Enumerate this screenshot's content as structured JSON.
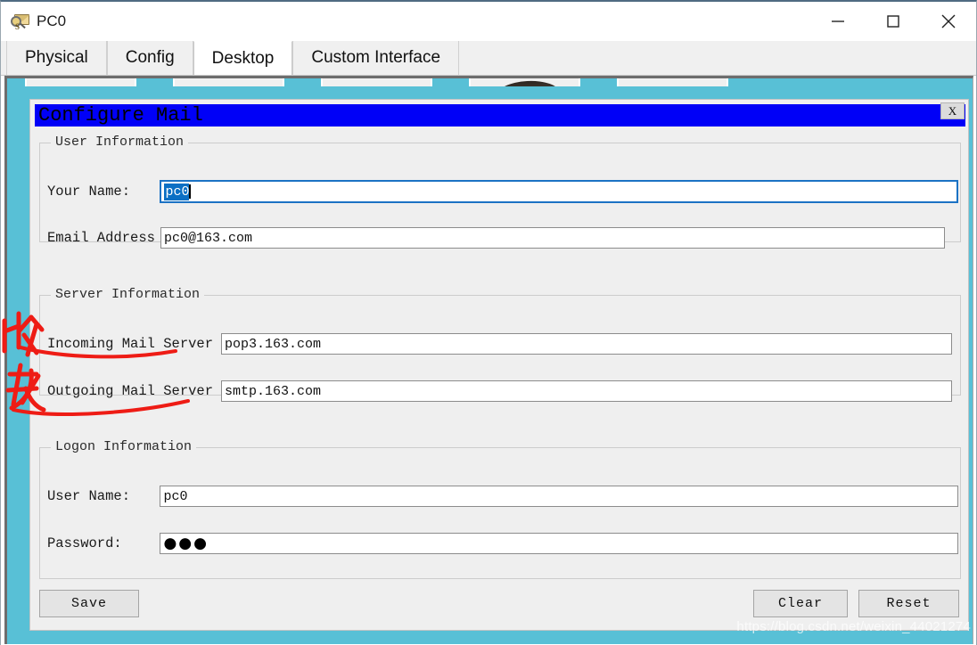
{
  "window": {
    "title": "PC0",
    "icon": "mail-search-icon",
    "controls": {
      "minimize": "minimize-icon",
      "maximize": "maximize-icon",
      "close": "close-icon"
    }
  },
  "tabs": [
    {
      "label": "Physical",
      "active": false
    },
    {
      "label": "Config",
      "active": false
    },
    {
      "label": "Desktop",
      "active": true
    },
    {
      "label": "Custom Interface",
      "active": false
    }
  ],
  "dialog": {
    "title": "Configure Mail",
    "close_label": "X",
    "titlebar_color": "#0000f7",
    "groups": {
      "user": {
        "title": "User Information",
        "fields": [
          {
            "label": "Your Name:",
            "value": "pc0",
            "focused": true,
            "selected": true
          },
          {
            "label": "Email Address",
            "value": "pc0@163.com",
            "focused": false,
            "selected": false
          }
        ]
      },
      "server": {
        "title": "Server Information",
        "fields": [
          {
            "label": "Incoming Mail Server",
            "value": "pop3.163.com",
            "focused": false,
            "selected": false
          },
          {
            "label": "Outgoing Mail Server",
            "value": "smtp.163.com",
            "focused": false,
            "selected": false
          }
        ]
      },
      "logon": {
        "title": "Logon Information",
        "fields": [
          {
            "label": "User Name:",
            "value": "pc0",
            "focused": false,
            "selected": false
          },
          {
            "label": "Password:",
            "value": "●●●",
            "focused": false,
            "selected": false
          }
        ]
      }
    },
    "buttons": {
      "save": "Save",
      "clear": "Clear",
      "reset": "Reset"
    }
  },
  "annotations": {
    "incoming_mark": "收",
    "outgoing_mark": "发",
    "ink_color": "#ee1c15"
  },
  "watermark": "https://blog.csdn.net/weixin_44021274",
  "desktop": {
    "background_color": "#58c0d6"
  }
}
